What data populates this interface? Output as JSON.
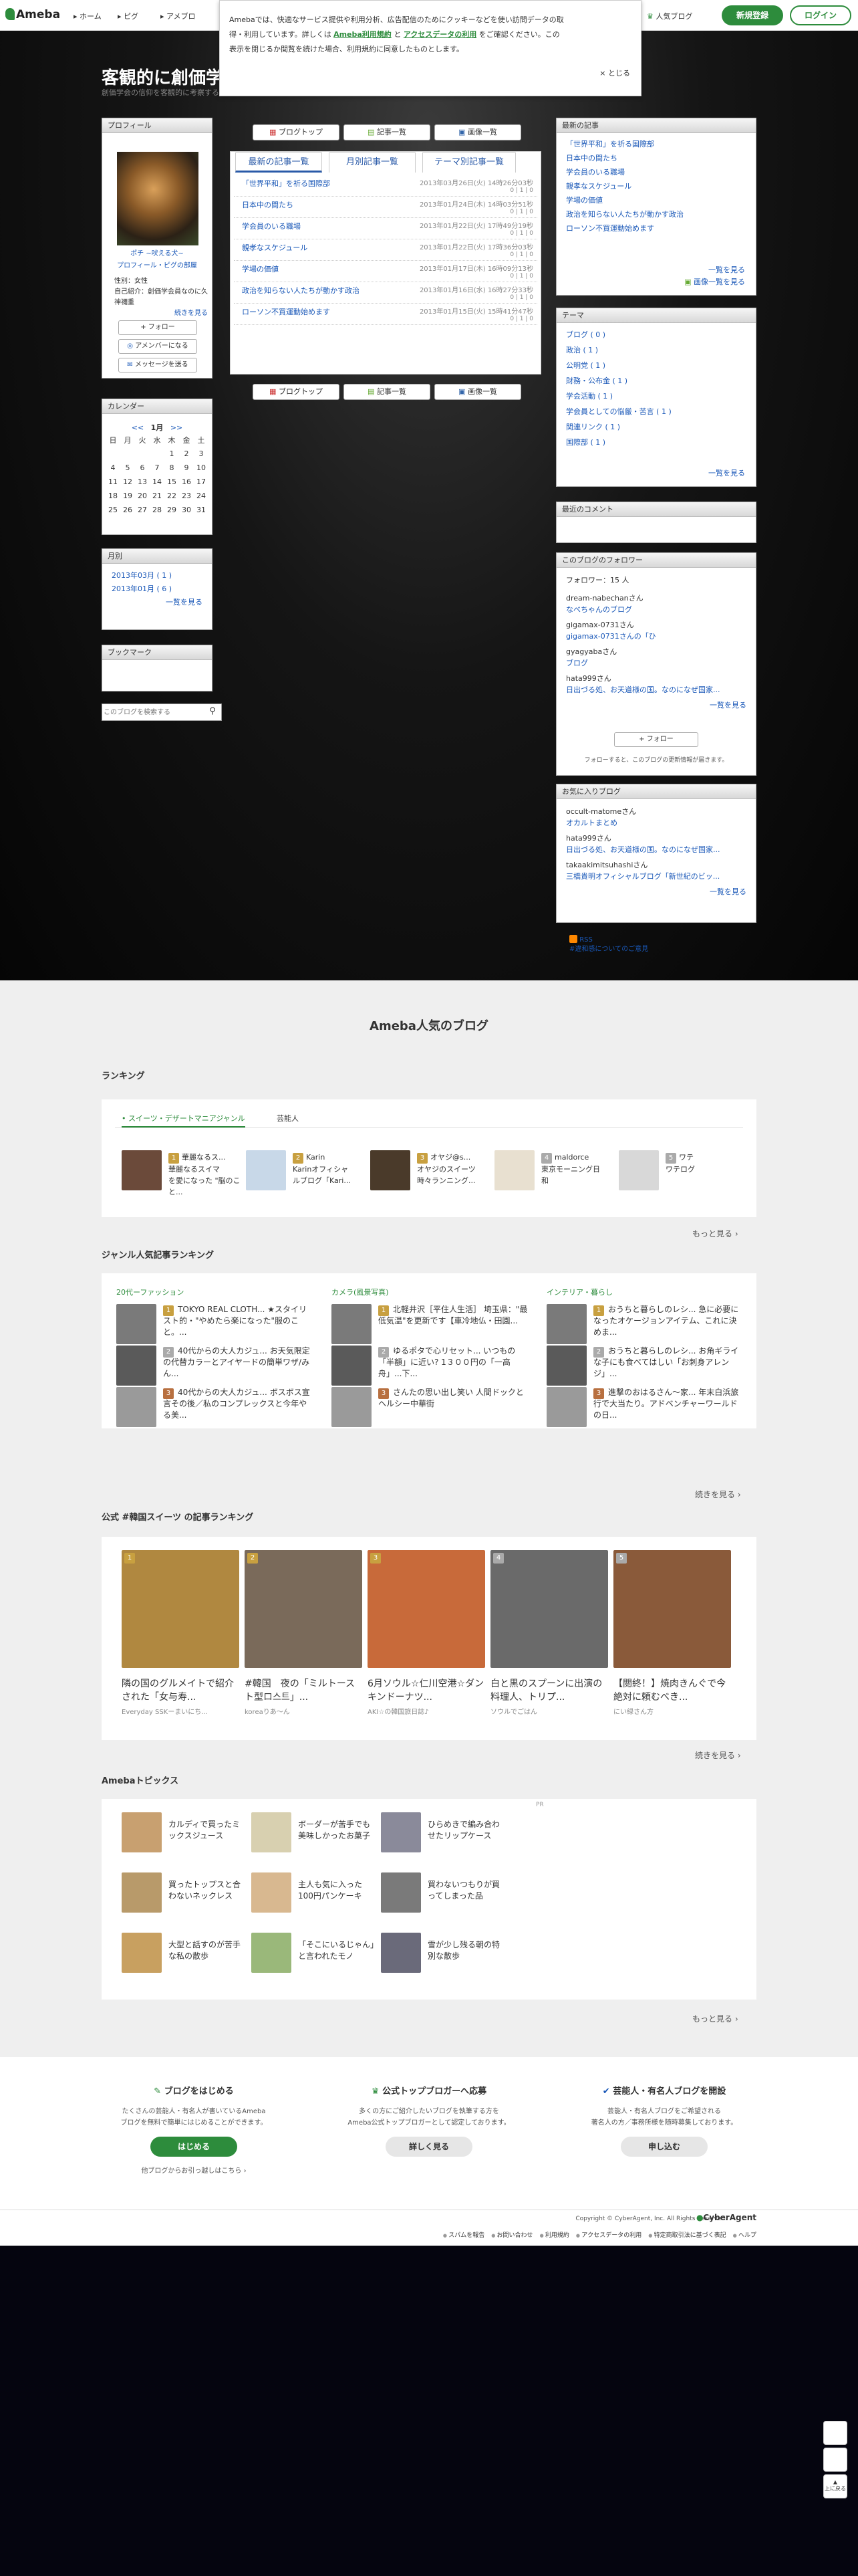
{
  "topbar": {
    "logo": "Ameba",
    "nav": [
      "ホーム",
      "ピグ",
      "アメブロ"
    ],
    "popular": "人気ブログ",
    "register": "新規登録",
    "login": "ログイン"
  },
  "notice": {
    "text1": "Amebaでは、快適なサービス提供や利用分析、広告配信のためにクッキーなどを使い訪問データの取",
    "text2": "得・利用しています。詳しくは",
    "link1": "Ameba利用規約",
    "and": "と",
    "link2": "アクセスデータの利用",
    "text3": "をご確認ください。この",
    "text4": "表示を閉じるか閲覧を続けた場合、利用規約に同意したものとします。",
    "close": "× とじる"
  },
  "blog": {
    "title": "客観的に創価学",
    "subtitle": "創価学会の信仰を客観的に考察するブログ"
  },
  "profile": {
    "header": "プロフィール",
    "name": "ポチ ~吠える犬~",
    "links": "プロフィール・ピグの部屋",
    "gender": "性別：女性",
    "self": "自己紹介：創価学会員なのに久神禰重",
    "more": "続きを見る",
    "follow": "+ フォロー",
    "amember": "アメンバーになる",
    "message": "メッセージを送る"
  },
  "calendar": {
    "header": "カレンダー",
    "prev": "<<",
    "month": "1月",
    "next": ">>",
    "days": [
      "日",
      "月",
      "火",
      "水",
      "木",
      "金",
      "土"
    ],
    "weeks": [
      [
        "",
        "",
        "",
        "",
        "1",
        "2",
        "3"
      ],
      [
        "4",
        "5",
        "6",
        "7",
        "8",
        "9",
        "10"
      ],
      [
        "11",
        "12",
        "13",
        "14",
        "15",
        "16",
        "17"
      ],
      [
        "18",
        "19",
        "20",
        "21",
        "22",
        "23",
        "24"
      ],
      [
        "25",
        "26",
        "27",
        "28",
        "29",
        "30",
        "31"
      ]
    ]
  },
  "monthly": {
    "header": "月別",
    "items": [
      "2013年03月 ( 1 )",
      "2013年01月 ( 6 )"
    ],
    "more": "一覧を見る"
  },
  "bookmark": {
    "header": "ブックマーク"
  },
  "search": {
    "placeholder": "このブログを検索する"
  },
  "main": {
    "btn_blog": "ブログトップ",
    "btn_list": "記事一覧",
    "btn_image": "画像一覧",
    "tabs": [
      "最新の記事一覧",
      "月別記事一覧",
      "テーマ別記事一覧"
    ],
    "entries": [
      {
        "title": "「世界平和」を祈る国際部",
        "date": "2013年03月26日(火) 14時26分03秒",
        "counts": "0 | 1 | 0"
      },
      {
        "title": "日本中の間たち",
        "date": "2013年01月24日(木) 14時03分51秒",
        "counts": "0 | 1 | 0"
      },
      {
        "title": "学会員のいる職場",
        "date": "2013年01月22日(火) 17時49分19秒",
        "counts": "0 | 1 | 0"
      },
      {
        "title": "親孝なスケジュール",
        "date": "2013年01月22日(火) 17時36分03秒",
        "counts": "0 | 1 | 0"
      },
      {
        "title": "学場の価値",
        "date": "2013年01月17日(木) 16時09分13秒",
        "counts": "0 | 1 | 0"
      },
      {
        "title": "政治を知らない人たちが動かす政治",
        "date": "2013年01月16日(水) 16時27分33秒",
        "counts": "0 | 1 | 0"
      },
      {
        "title": "ローソン不買運動始めます",
        "date": "2013年01月15日(火) 15時41分47秒",
        "counts": "0 | 1 | 0"
      }
    ]
  },
  "recent": {
    "header": "最新の記事",
    "items": [
      "「世界平和」を祈る国際部",
      "日本中の間たち",
      "学会員のいる職場",
      "親孝なスケジュール",
      "学場の価値",
      "政治を知らない人たちが動かす政治",
      "ローソン不買運動始めます"
    ],
    "more": "一覧を見る",
    "imgmore": "画像一覧を見る"
  },
  "theme": {
    "header": "テーマ",
    "items": [
      "ブログ ( 0 )",
      "政治 ( 1 )",
      "公明党 ( 1 )",
      "財務・公布金 ( 1 )",
      "学会活動 ( 1 )",
      "学会員としての悩厳・苦言 ( 1 )",
      "関連リンク ( 1 )",
      "国際部 ( 1 )"
    ],
    "more": "一覧を見る"
  },
  "comments": {
    "header": "最近のコメント"
  },
  "followers": {
    "header": "このブログのフォロワー",
    "count": "フォロワー：15 人",
    "list": [
      {
        "user": "dream-nabechanさん",
        "blog": "なべちゃんのブログ"
      },
      {
        "user": "gigamax-0731さん",
        "blog": "gigamax-0731さんの「ひ"
      },
      {
        "user": "gyagyabaさん",
        "blog": "ブログ"
      },
      {
        "user": "hata999さん",
        "blog": "日出づる処、お天道様の国。なのになぜ国家..."
      }
    ],
    "more": "一覧を見る",
    "follow": "+ フォロー",
    "note": "フォローすると、このブログの更新情報が届きます。"
  },
  "favorites": {
    "header": "お気に入りブログ",
    "list": [
      {
        "user": "occult-matomeさん",
        "blog": "オカルトまとめ"
      },
      {
        "user": "hata999さん",
        "blog": "日出づる処、お天道様の国。なのになぜ国家..."
      },
      {
        "user": "takaakimitsuhashiさん",
        "blog": "三橋貴明オフィシャルブログ「新世紀のビッ..."
      }
    ],
    "more": "一覧を見る"
  },
  "rss": {
    "label": "RSS",
    "sub": "#違和感についてのご意見"
  },
  "popular": {
    "title": "Ameba人気のブログ",
    "ranking": "ランキング",
    "tabs": [
      "スイーツ・デザートマニアジャンル",
      "芸能人"
    ],
    "rank_items": [
      {
        "n": "1",
        "t": "華麗なるス...",
        "s": "華麗なるスイマ\nを愛になった \"脳のこと..."
      },
      {
        "n": "2",
        "t": "Karin",
        "s": "Karinオフィシャ\nルブログ「Kari..."
      },
      {
        "n": "3",
        "t": "オヤジ@s...",
        "s": "オヤジのスイーツ\n時々ランニング..."
      },
      {
        "n": "4",
        "t": "maldorce",
        "s": "東京モーニング日\n和"
      },
      {
        "n": "5",
        "t": "ワテ",
        "s": "ワテログ"
      }
    ],
    "more": "もっと見る"
  },
  "genre": {
    "title": "ジャンル人気記事ランキング",
    "cols": [
      {
        "name": "20代ーファッション",
        "items": [
          "TOKYO REAL CLOTH... ★スタイリスト的・\"やめたら楽になった\"服のこと。...",
          "40代からの大人カジュ... お天気限定の代替カラーとアイヤードの簡単ワザ/みん...",
          "40代からの大人カジュ... ボスボス宣言その後／私のコンプレックスと今年やる美..."
        ]
      },
      {
        "name": "カメラ(風景写真)",
        "items": [
          "北軽井沢［平住人生活］ 埼玉県：\"最低気温\"を更新です【車冷地仏・田園...",
          "ゆるポタで心リセット... いつもの「半額」に近い? 1３００円の「一高舟」...下...",
          "さんたの思い出し笑い 人間ドックとヘルシー中華街"
        ]
      },
      {
        "name": "インテリア・暮らし",
        "items": [
          "おうちと暮らしのレシ... 急に必要になったオケージョンアイテム、これに決めま...",
          "おうちと暮らしのレシ... お角ギライな子にも食べてはしい「お刺身アレンジ」...",
          "進撃のおはるさん〜家... 年末白浜旅行で大当たり。アドベンチャーワールドの日..."
        ]
      }
    ],
    "more": "続きを見る"
  },
  "korean": {
    "title": "公式 #韓国スイーツ の記事ランキング",
    "items": [
      {
        "n": "1",
        "t": "隣の国のグルメイトで紹介された「女与寿...",
        "a": "Everyday SSKーまいにち..."
      },
      {
        "n": "2",
        "t": "#韓国　夜の「ミルトースト型ロ스트」...",
        "a": "koreaりあ〜ん"
      },
      {
        "n": "3",
        "t": "6月ソウル☆仁川空港☆ダンキンドーナツ...",
        "a": "AKI☆の韓国旅日誌♪"
      },
      {
        "n": "4",
        "t": "白と黒のスプーンに出演の料理人、トリプ...",
        "a": "ソウルでごはん"
      },
      {
        "n": "5",
        "t": "【閲終！】焼肉きんぐで今絶対に頼むべき...",
        "a": "にい緑さん方"
      }
    ],
    "more": "続きを見る"
  },
  "topics": {
    "title": "Amebaトピックス",
    "pr": "PR",
    "items": [
      "カルディで買ったミックスジュース",
      "ボーダーが苦手でも美味しかったお菓子",
      "ひらめきで編み合わせたリップケース",
      "買ったトップスと合わないネックレス",
      "主人も気に入った100円パンケーキ",
      "買わないつもりが買ってしまった品",
      "大型と話すのが苦手な私の散歩",
      "「そこにいるじゃん」と言われたモノ",
      "雪が少し残る朝の特別な散歩"
    ],
    "more": "もっと見る"
  },
  "footer": {
    "c1": {
      "h": "ブログをはじめる",
      "d": "たくさんの芸能人・有名人が書いているAmeba\nブログを無料で簡単にはじめることができます。",
      "b": "はじめる",
      "l": "他ブログからお引っ越しはこちら"
    },
    "c2": {
      "h": "公式トップブロガーへ応募",
      "d": "多くの方にご紹介したいブログを執筆する方を\nAmeba公式トップブロガーとして認定しております。",
      "b": "詳しく見る"
    },
    "c3": {
      "h": "芸能人・有名人ブログを開設",
      "d": "芸能人・有名人ブログをご希望される\n著名人の方／事務所様を随時募集しております。",
      "b": "申し込む"
    },
    "copy": "Copyright © CyberAgent, Inc. All Rights Reserved.",
    "ca": "CyberAgent",
    "links": [
      "スパムを報告",
      "お問い合わせ",
      "利用規約",
      "アクセスデータの利用",
      "特定商取引法に基づく表記",
      "ヘルプ"
    ]
  },
  "side": {
    "top": "上に戻る"
  },
  "colors": {
    "green": "#2d8c3c",
    "link": "#1a58b8"
  }
}
